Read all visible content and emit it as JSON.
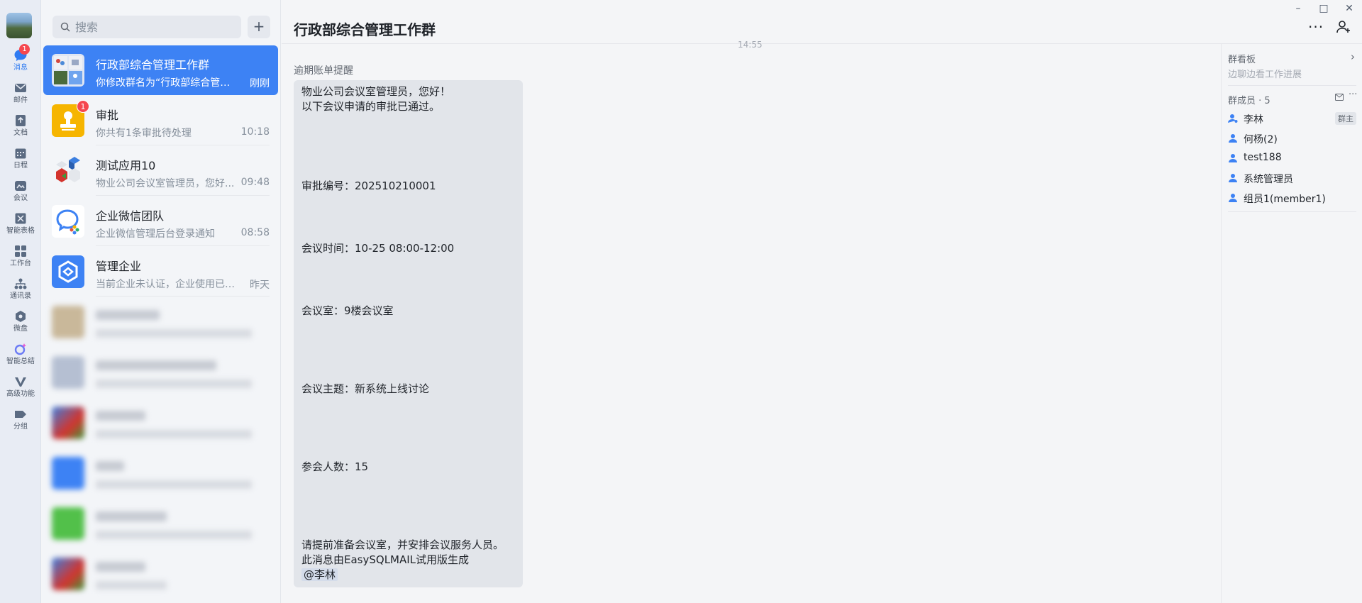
{
  "nav": {
    "items": [
      {
        "label": "消息",
        "badge": "1",
        "icon": "chat-bubble-icon"
      },
      {
        "label": "邮件",
        "icon": "mail-icon"
      },
      {
        "label": "文档",
        "icon": "document-icon"
      },
      {
        "label": "日程",
        "icon": "calendar-icon"
      },
      {
        "label": "会议",
        "icon": "meeting-icon"
      },
      {
        "label": "智能表格",
        "icon": "smart-table-icon"
      },
      {
        "label": "工作台",
        "icon": "workbench-grid-icon"
      },
      {
        "label": "通讯录",
        "icon": "contacts-tree-icon"
      },
      {
        "label": "微盘",
        "icon": "drive-icon"
      },
      {
        "label": "智能总结",
        "icon": "ai-summary-icon"
      },
      {
        "label": "高级功能",
        "icon": "advanced-v-icon"
      },
      {
        "label": "分组",
        "icon": "tag-group-icon"
      }
    ]
  },
  "search": {
    "placeholder": "搜索"
  },
  "conversations": [
    {
      "name": "行政部综合管理工作群",
      "snippet": "你修改群名为“行政部综合管理...",
      "time": "刚刚",
      "active": true
    },
    {
      "name": "审批",
      "snippet": "你共有1条审批待处理",
      "time": "10:18",
      "badge": "1"
    },
    {
      "name": "测试应用10",
      "snippet": "物业公司会议室管理员，您好...",
      "time": "09:48"
    },
    {
      "name": "企业微信团队",
      "snippet": "企业微信管理后台登录通知",
      "time": "08:58"
    },
    {
      "name": "管理企业",
      "snippet": "当前企业未认证，企业使用已受...",
      "time": "昨天"
    }
  ],
  "chat": {
    "title": "行政部综合管理工作群",
    "timestamp": "14:55",
    "sender": "逾期账单提醒",
    "lines": [
      "物业公司会议室管理员，您好！",
      "以下会议申请的审批已通过。",
      "审批编号：202510210001",
      "会议时间：10-25 08:00-12:00",
      "会议室：9楼会议室",
      "会议主题：新系统上线讨论",
      "参会人数：15",
      "请提前准备会议室，并安排会议服务人员。",
      "此消息由EasySQLMAIL试用版生成",
      "@李林"
    ]
  },
  "panel": {
    "board_title": "群看板",
    "board_sub": "边聊边看工作进展",
    "members_title": "群成员 · 5",
    "members": [
      {
        "name": "李林",
        "tag": "群主"
      },
      {
        "name": "何杨(2)"
      },
      {
        "name": "test188"
      },
      {
        "name": "系统管理员"
      },
      {
        "name": "组员1(member1)"
      }
    ]
  },
  "colors": {
    "accent": "#3d82f4",
    "badge": "#f5474f",
    "approval": "#f6b500",
    "app_blue": "#3d82f4"
  }
}
